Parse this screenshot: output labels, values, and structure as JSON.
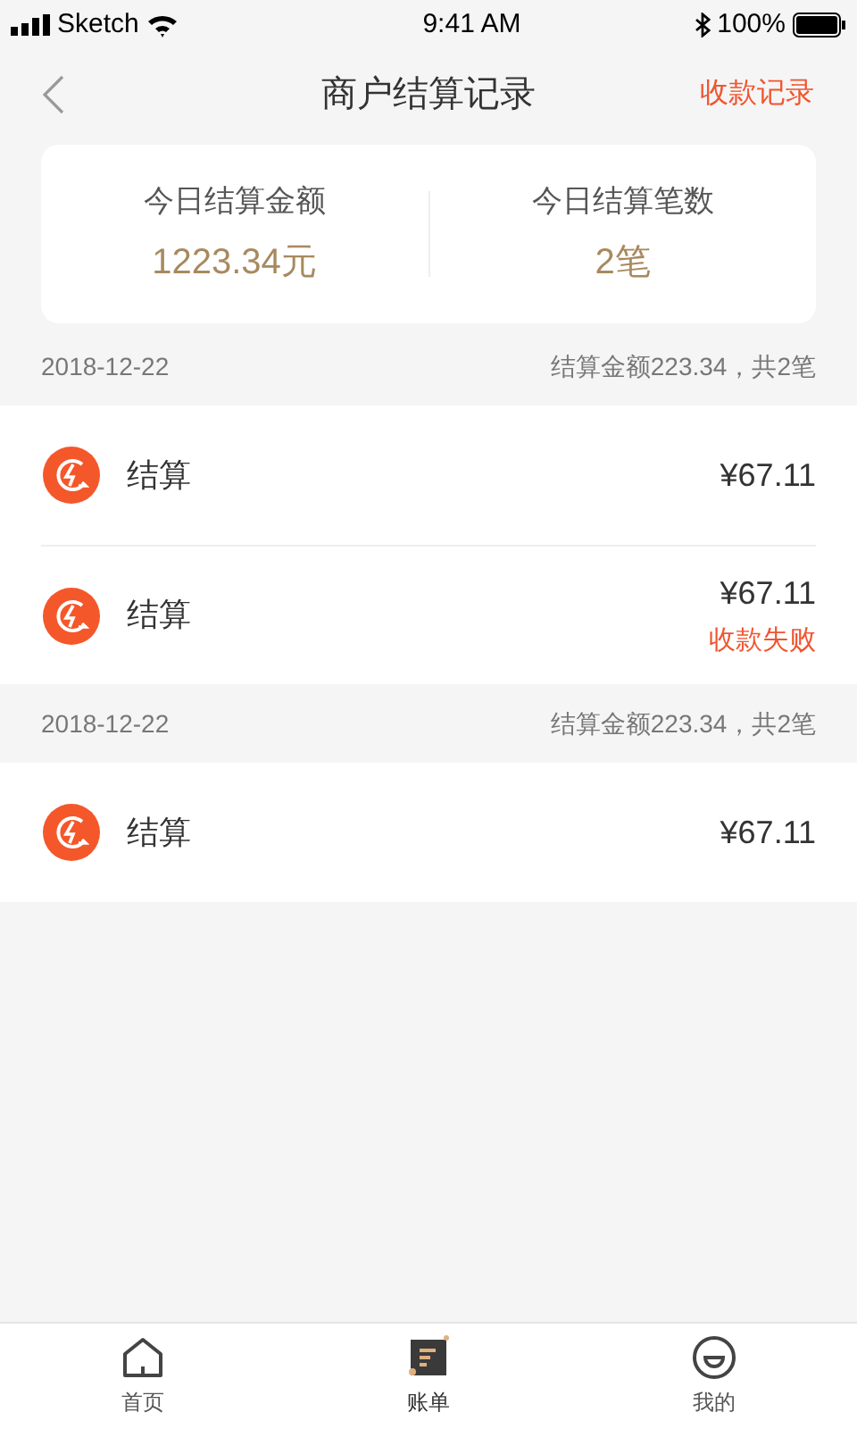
{
  "status_bar": {
    "carrier": "Sketch",
    "time": "9:41 AM",
    "battery": "100%"
  },
  "nav": {
    "title": "商户结算记录",
    "action": "收款记录"
  },
  "summary": [
    {
      "label": "今日结算金额",
      "value": "1223.34元"
    },
    {
      "label": "今日结算笔数",
      "value": "2笔"
    }
  ],
  "groups": [
    {
      "date": "2018-12-22",
      "total": "结算金额223.34，共2笔",
      "items": [
        {
          "name": "结算",
          "amount": "¥67.11"
        },
        {
          "name": "结算",
          "amount": "¥67.11",
          "status": "收款失败"
        }
      ]
    },
    {
      "date": "2018-12-22",
      "total": "结算金额223.34，共2笔",
      "items": [
        {
          "name": "结算",
          "amount": "¥67.11"
        }
      ]
    }
  ],
  "tabs": [
    {
      "label": "首页",
      "kind": "home",
      "selected": false
    },
    {
      "label": "账单",
      "kind": "bill",
      "selected": true
    },
    {
      "label": "我的",
      "kind": "me",
      "selected": false
    }
  ]
}
